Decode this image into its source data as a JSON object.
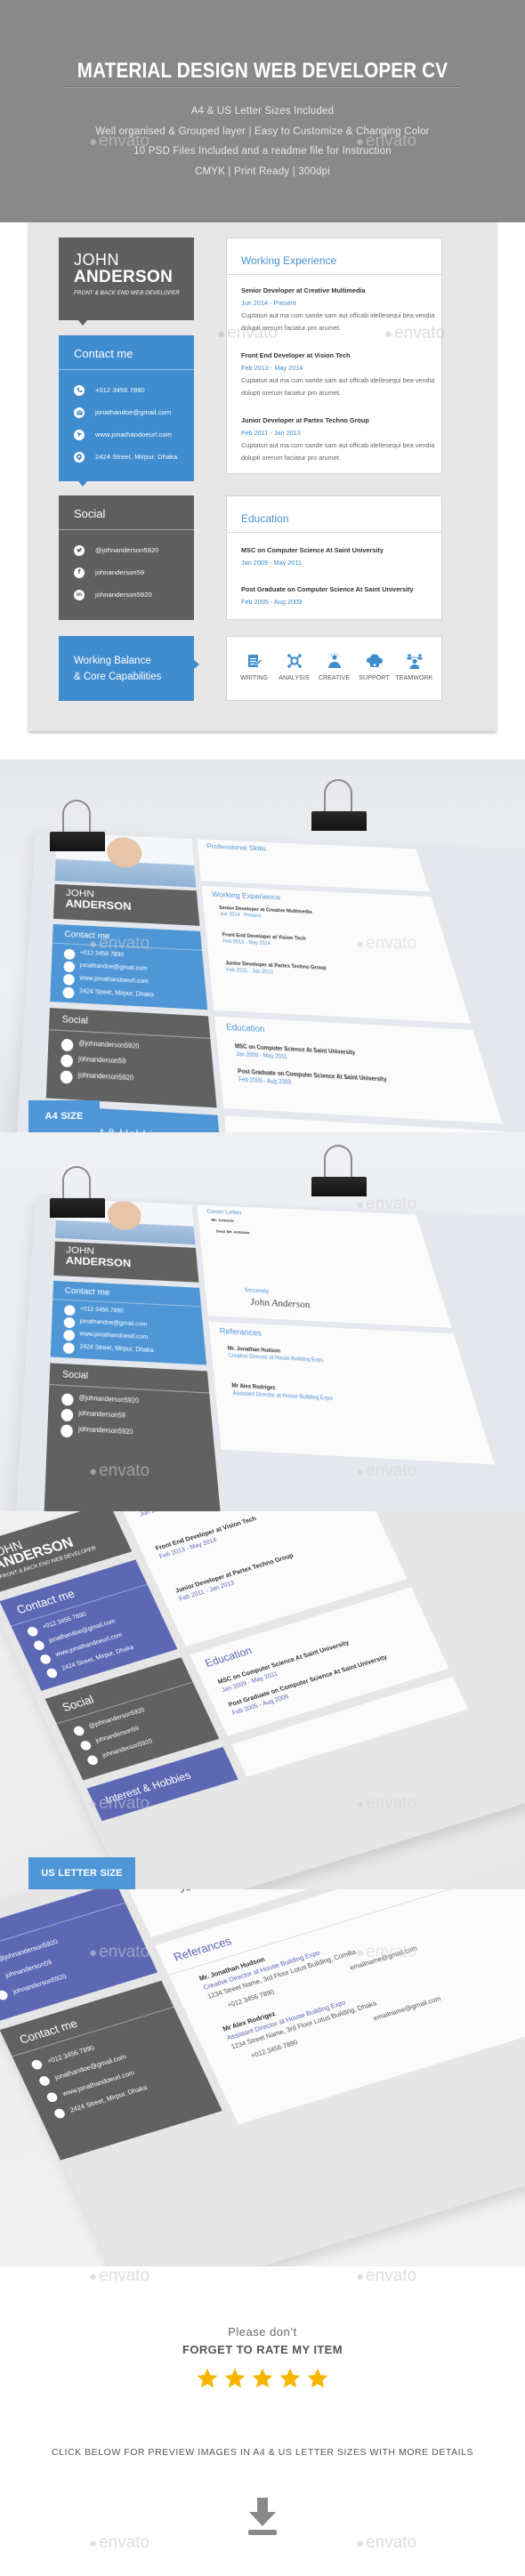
{
  "header": {
    "title": "MATERIAL DESIGN WEB DEVELOPER CV",
    "features": [
      "A4 & US Letter Sizes Included",
      "Well organised & Grouped layer | Easy to Customize & Changing Color",
      "10 PSD Files Included and a readme file for Instruction",
      "CMYK | Print Ready | 300dpi"
    ]
  },
  "watermark": "envato",
  "colors": {
    "primary_blue": "#3f8ccf",
    "dark_gray": "#5f5f5f",
    "alt_purple": "#5c68b4",
    "star_yellow": "#f7b500",
    "header_gray": "#898989"
  },
  "cv": {
    "first_name": "JOHN",
    "last_name": "ANDERSON",
    "role": "FRONT & BACK END WEB DEVELOPER",
    "contact": {
      "title": "Contact me",
      "items": [
        {
          "icon": "phone-icon",
          "text": "+012 3456 7890"
        },
        {
          "icon": "email-icon",
          "text": "jonathandoe@gmail.com"
        },
        {
          "icon": "web-icon",
          "text": "www.jonathandoeurl.com"
        },
        {
          "icon": "location-icon",
          "text": "2424 Street, Mirpur, Dhaka"
        }
      ]
    },
    "social": {
      "title": "Social",
      "items": [
        {
          "icon": "twitter-icon",
          "glyph": "t",
          "text": "@johnanderson5920"
        },
        {
          "icon": "facebook-icon",
          "glyph": "f",
          "text": "johnanderson59"
        },
        {
          "icon": "linkedin-icon",
          "glyph": "in",
          "text": "johnanderson5920"
        }
      ]
    },
    "capabilities_title_line1": "Working Balance",
    "capabilities_title_line2": "& Core Capabilities",
    "experience": {
      "title": "Working Experience",
      "items": [
        {
          "position": "Senior Developer at Creative Multimedia",
          "date": "Jun 2014 - Present",
          "desc": "Cuptaturi aut ma cum sande sam aut officab idellesequi bea vendia dolupti orerum faciatur pro arumet."
        },
        {
          "position": "Front End Developer at Vision Tech",
          "date": "Feb 2013 - May 2014",
          "desc": "Cuptaturi aut ma cum sande sam aut officab idellesequi bea vendia dolupti orerum faciatur pro arumet."
        },
        {
          "position": "Junior Developer at Partex Techno Group",
          "date": "Feb 2011 - Jan 2013",
          "desc": "Cuptaturi aut ma cum sande sam aut officab idellesequi bea vendia dolupti orerum faciatur pro arumet."
        }
      ]
    },
    "education": {
      "title": "Education",
      "items": [
        {
          "degree": "MSC on Computer Science At Saint University",
          "date": "Jan 2009 - May 2011"
        },
        {
          "degree": "Post Graduate on Computer Science At Saint University",
          "date": "Feb 2005 - Aug 2009"
        }
      ]
    },
    "skills": [
      {
        "icon": "writing-icon",
        "label": "WRITING"
      },
      {
        "icon": "analysis-icon",
        "label": "ANALYSIS"
      },
      {
        "icon": "creative-icon",
        "label": "CREATIVE"
      },
      {
        "icon": "support-icon",
        "label": "SUPPORT"
      },
      {
        "icon": "teamwork-icon",
        "label": "TEAMWORK"
      }
    ]
  },
  "previews": {
    "a4_label": "A4 SIZE",
    "us_label": "US LETTER SIZE",
    "professional_skills": "Professional Skills",
    "interest_hobbies": "Interest & Hobbies",
    "cover_letter": "Cover Letter",
    "cover_recipient": "Mr. Antonio",
    "cover_greeting": "Dear Mr. Antonio",
    "sincerely": "Sincerely",
    "signature": "John Anderson",
    "references": {
      "title": "Referances",
      "items": [
        {
          "name": "Mr. Jonathan Hudson",
          "title": "Creative Director at House Building Expo",
          "address": "1234 Street Name, 3rd Floor Lotus Building, Comilla",
          "phone": "+012 3456 7890",
          "email": "emailname@gmail.com"
        },
        {
          "name": "Mr Alex Rodrigez",
          "title": "Assistant Director at House Building Expo",
          "address": "1234 Street Name, 3rd Floor Lotus Building, Dhaka",
          "phone": "+012 3456 7890",
          "email": "emailname@gmail.com"
        }
      ]
    }
  },
  "footer": {
    "please": "Please don’t",
    "rate": "FORGET TO RATE MY ITEM",
    "rating": 5,
    "rating_max": 5,
    "click_text": "CLICK BELOW FOR PREVIEW IMAGES IN A4 & US LETTER SIZES WITH MORE DETAILS"
  }
}
